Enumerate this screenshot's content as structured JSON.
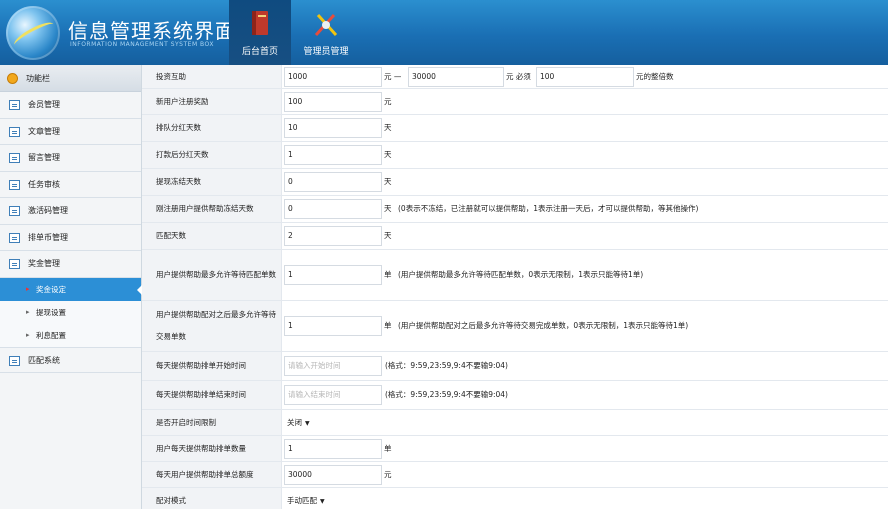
{
  "header": {
    "title": "信息管理系统界面",
    "subtitle": "INFORMATION MANAGEMENT SYSTEM BOX",
    "nav": [
      {
        "label": "后台首页",
        "icon": "book-icon",
        "active": true
      },
      {
        "label": "管理员管理",
        "icon": "tools-icon",
        "active": false
      }
    ]
  },
  "sidebar": {
    "heading": "功能栏",
    "items": [
      {
        "label": "会员管理"
      },
      {
        "label": "文章管理"
      },
      {
        "label": "留言管理"
      },
      {
        "label": "任务审核"
      },
      {
        "label": "激活码管理"
      },
      {
        "label": "排单币管理"
      },
      {
        "label": "奖金管理"
      }
    ],
    "subitems": [
      {
        "label": "奖金设定",
        "active": true
      },
      {
        "label": "提现设置",
        "active": false
      },
      {
        "label": "利息配置",
        "active": false
      }
    ],
    "last_item": {
      "label": "匹配系统"
    }
  },
  "form": {
    "rows": {
      "r1": {
        "label": "投资互助",
        "min": "1000",
        "sep": "元 —",
        "max": "30000",
        "unit_a": "元 必须",
        "multiple": "100",
        "unit_b": "元的整倍数"
      },
      "r2": {
        "label": "新用户注册奖励",
        "value": "100",
        "unit": "元"
      },
      "r3": {
        "label": "排队分红天数",
        "value": "10",
        "unit": "天"
      },
      "r4": {
        "label": "打款后分红天数",
        "value": "1",
        "unit": "天"
      },
      "r5": {
        "label": "提现冻结天数",
        "value": "0",
        "unit": "天"
      },
      "r6": {
        "label": "刚注册用户提供帮助冻结天数",
        "value": "0",
        "unit": "天",
        "note": "(0表示不冻结，已注册就可以提供帮助，1表示注册一天后，才可以提供帮助，等其他操作)"
      },
      "r7": {
        "label": "匹配天数",
        "value": "2",
        "unit": "天"
      },
      "r8": {
        "label": "用户提供帮助最多允许等待匹配单数",
        "value": "1",
        "unit": "单",
        "note": "(用户提供帮助最多允许等待匹配单数，0表示无限制，1表示只能等待1单)"
      },
      "r9": {
        "label": "用户提供帮助配对之后最多允许等待交易单数",
        "value": "1",
        "unit": "单",
        "note": "(用户提供帮助配对之后最多允许等待交易完成单数，0表示无限制，1表示只能等待1单)"
      },
      "r10": {
        "label": "每天提供帮助排单开始时间",
        "placeholder": "请输入开始时间",
        "note": "(格式：9:59,23:59,9:4不要输9:04)"
      },
      "r11": {
        "label": "每天提供帮助排单结束时间",
        "placeholder": "请输入结束时间",
        "note": "(格式：9:59,23:59,9:4不要输9:04)"
      },
      "r12": {
        "label": "是否开启时间限制",
        "value": "关闭"
      },
      "r13": {
        "label": "用户每天提供帮助排单数量",
        "value": "1",
        "unit": "单"
      },
      "r14": {
        "label": "每天用户提供帮助排单总额度",
        "value": "30000",
        "unit": "元"
      },
      "r15": {
        "label": "配对模式",
        "value": "手动匹配"
      }
    }
  },
  "colors": {
    "header_blue": "#1a6fb4",
    "active_blue": "#2c8fd6",
    "accent_orange": "#f2a81c"
  }
}
